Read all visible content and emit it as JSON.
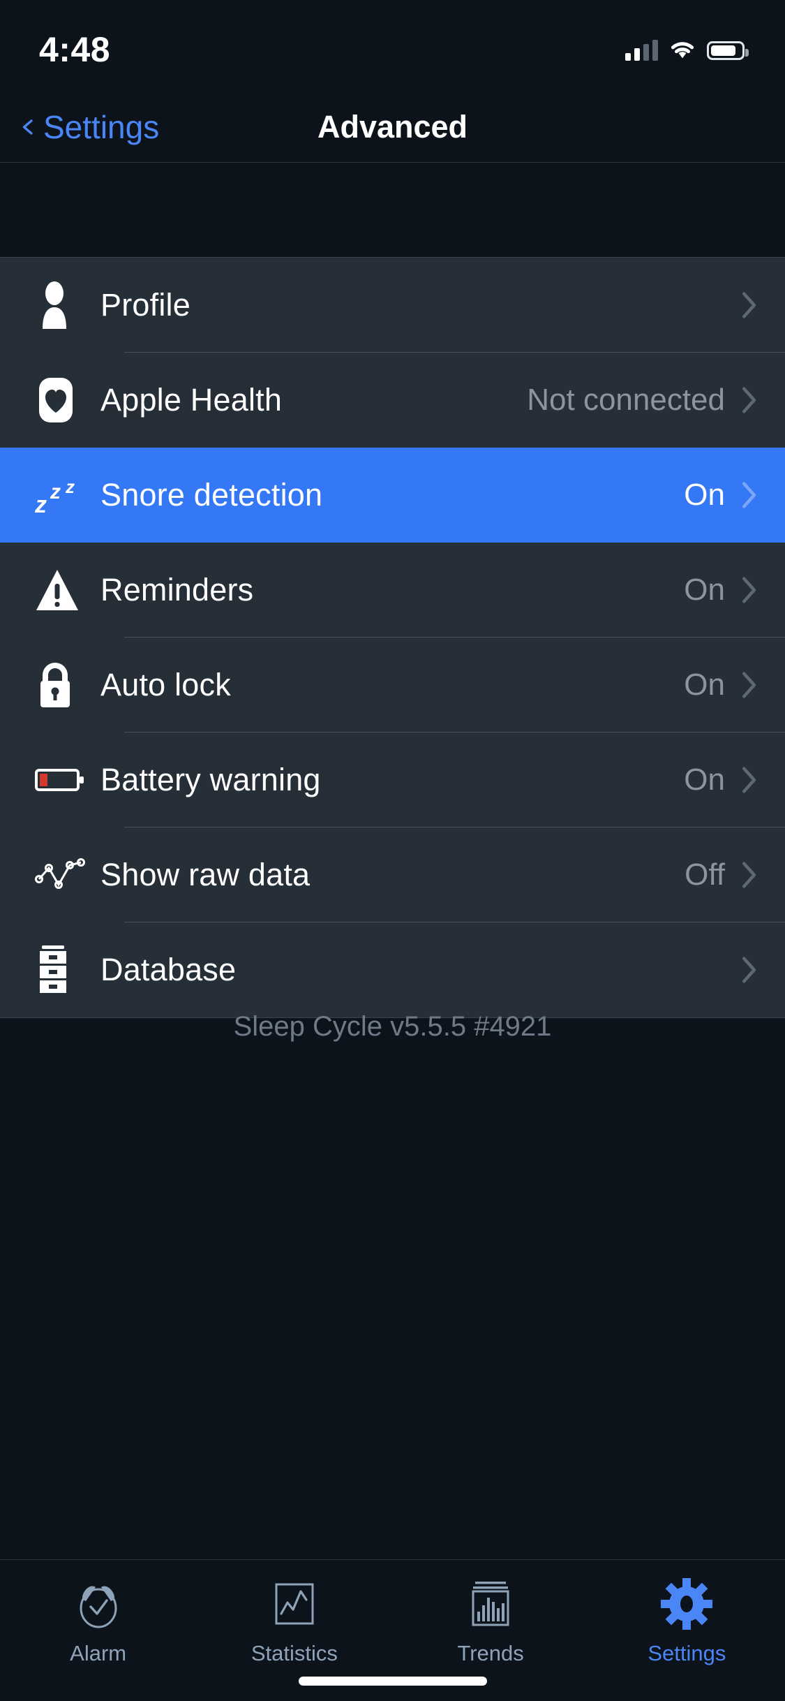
{
  "status_bar": {
    "time": "4:48",
    "cellular_icon": "cellular-signal-icon",
    "wifi_icon": "wifi-icon",
    "battery_icon": "battery-icon"
  },
  "nav": {
    "back_label": "Settings",
    "back_icon": "chevron-left-icon",
    "title": "Advanced"
  },
  "colors": {
    "accent": "#4b86f7",
    "selected_row": "#3478f6",
    "row_background": "#262e38",
    "page_background": "#0c131b",
    "value_text": "#8c949e",
    "battery_low": "#d4392f"
  },
  "list": {
    "rows": [
      {
        "label": "Profile",
        "value": "",
        "icon": "person-icon",
        "selected": false
      },
      {
        "label": "Apple Health",
        "value": "Not connected",
        "icon": "heart-icon",
        "selected": false
      },
      {
        "label": "Snore detection",
        "value": "On",
        "icon": "zzz-icon",
        "selected": true
      },
      {
        "label": "Reminders",
        "value": "On",
        "icon": "warning-triangle-icon",
        "selected": false
      },
      {
        "label": "Auto lock",
        "value": "On",
        "icon": "lock-icon",
        "selected": false
      },
      {
        "label": "Battery warning",
        "value": "On",
        "icon": "battery-low-icon",
        "selected": false
      },
      {
        "label": "Show raw data",
        "value": "Off",
        "icon": "line-chart-icon",
        "selected": false
      },
      {
        "label": "Database",
        "value": "",
        "icon": "database-icon",
        "selected": false
      }
    ],
    "chevron_icon": "chevron-right-icon"
  },
  "footer": {
    "version": "Sleep Cycle v5.5.5 #4921"
  },
  "tabbar": {
    "tabs": [
      {
        "label": "Alarm",
        "icon": "alarm-clock-icon",
        "active": false
      },
      {
        "label": "Statistics",
        "icon": "line-graph-icon",
        "active": false
      },
      {
        "label": "Trends",
        "icon": "bar-graph-icon",
        "active": false
      },
      {
        "label": "Settings",
        "icon": "gear-icon",
        "active": true
      }
    ]
  }
}
